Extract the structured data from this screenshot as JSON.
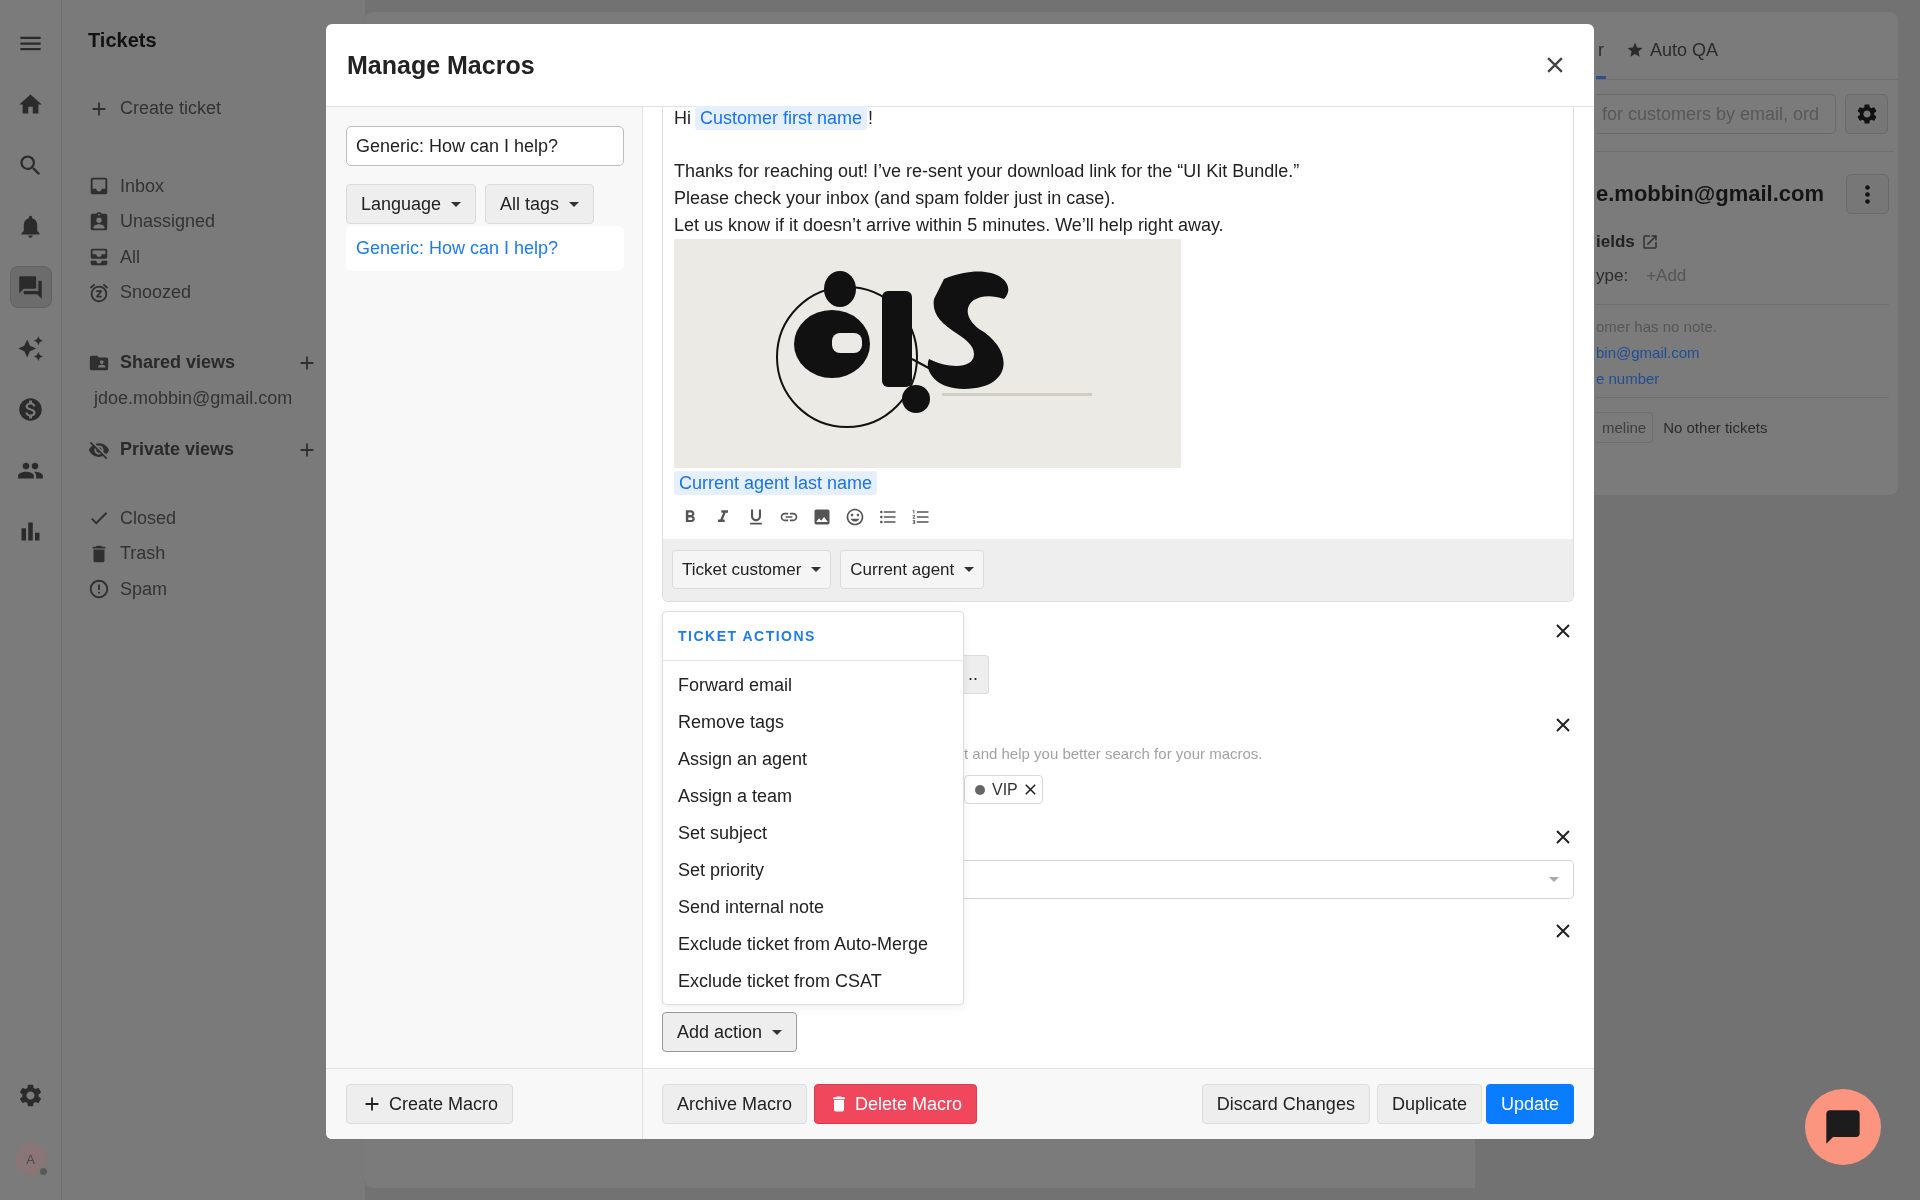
{
  "rail": {
    "items": [
      {
        "kind": "menu",
        "selected": false
      },
      {
        "kind": "home",
        "selected": false
      },
      {
        "kind": "search",
        "selected": false
      },
      {
        "kind": "bell",
        "selected": false
      },
      {
        "kind": "chat",
        "selected": true
      },
      {
        "kind": "sparkle",
        "selected": false
      },
      {
        "kind": "dollar",
        "selected": false
      },
      {
        "kind": "people",
        "selected": false
      },
      {
        "kind": "chart",
        "selected": false
      }
    ],
    "settings": {
      "kind": "settings",
      "selected": false
    },
    "avatar": "A"
  },
  "sidebar": {
    "title": "Tickets",
    "create": "Create ticket",
    "views": [
      {
        "kind": "inbox",
        "label": "Inbox"
      },
      {
        "kind": "unassigned",
        "label": "Unassigned"
      },
      {
        "kind": "all",
        "label": "All"
      },
      {
        "kind": "snoozed",
        "label": "Snoozed"
      }
    ],
    "shared": {
      "title": "Shared views",
      "items": [
        "jdoe.mobbin@gmail.com"
      ]
    },
    "private": {
      "title": "Private views"
    },
    "folders": [
      {
        "kind": "closed",
        "label": "Closed"
      },
      {
        "kind": "trash",
        "label": "Trash"
      },
      {
        "kind": "spam",
        "label": "Spam"
      }
    ]
  },
  "customer_panel": {
    "tabs": [
      {
        "label": "r",
        "selected": true
      },
      {
        "label": "Auto QA",
        "selected": false
      }
    ],
    "search": {
      "placeholder": "for customers by email, ord"
    },
    "name": "e.mobbin@gmail.com",
    "fields_title": "ields",
    "field": {
      "label": "ype:",
      "value": "+Add"
    },
    "note": "omer has no note.",
    "links": [
      "bin@gmail.com",
      "e number"
    ],
    "timeline_button": "meline",
    "other_tickets": "No other tickets"
  },
  "modal": {
    "title": "Manage Macros",
    "search": {
      "value": "Generic: How can I help?"
    },
    "filters": [
      "Language",
      "All tags"
    ],
    "macros": [
      {
        "label": "Generic: How can I help?",
        "selected": true
      }
    ],
    "editor": {
      "greeting": "Hi",
      "first_name_variable": "Customer first name",
      "exclamation": "!",
      "lines": [
        "Thanks for reaching out! I’ve re-sent your download link for the “UI Kit Bundle.”",
        "Please check your inbox (and spam folder just in case).",
        "Let us know if it doesn’t arrive within 5 minutes. We’ll help right away."
      ],
      "image": {
        "kind": "picture"
      },
      "signature_variable": "Current agent last name",
      "variable_menus": [
        "Ticket customer",
        "Current agent"
      ]
    },
    "actions": [
      {
        "kind": "button",
        "text": ".."
      },
      {
        "kind": "tags",
        "hint": "t and help you better search for your macros.",
        "tags": [
          "VIP"
        ]
      },
      {
        "kind": "select"
      },
      {
        "kind": "empty"
      }
    ],
    "action_menu": {
      "heading": "TICKET ACTIONS",
      "items": [
        "Forward email",
        "Remove tags",
        "Assign an agent",
        "Assign a team",
        "Set subject",
        "Set priority",
        "Send internal note",
        "Exclude ticket from Auto-Merge",
        "Exclude ticket from CSAT"
      ]
    },
    "add_action": "Add action",
    "footer": {
      "create": "Create Macro",
      "archive": "Archive Macro",
      "delete": "Delete Macro",
      "discard": "Discard Changes",
      "duplicate": "Duplicate",
      "update": "Update"
    }
  }
}
